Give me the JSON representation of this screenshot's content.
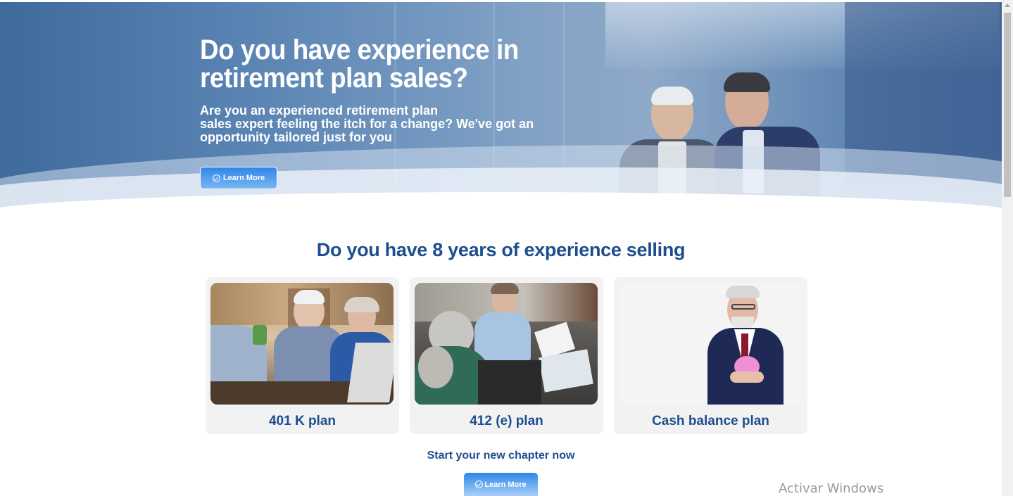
{
  "hero": {
    "title": "Do you have experience in retirement plan sales?",
    "subtitle": "Are you an experienced retirement plan\nsales expert  feeling the itch for a change? We've got an\nopportunity tailored just for you",
    "button_label": "Learn More",
    "button_icon": "check-circle-icon"
  },
  "section": {
    "title": "Do you have 8 years of experience selling",
    "cards": [
      {
        "label": "401 K plan"
      },
      {
        "label": "412 (e) plan"
      },
      {
        "label": "Cash balance plan"
      }
    ]
  },
  "cta": {
    "text": "Start your new chapter now",
    "button_label": "Learn More",
    "button_icon": "check-circle-icon"
  },
  "overlay": {
    "watermark": "Activar Windows"
  },
  "colors": {
    "heading_blue": "#1e4d8f",
    "button_blue": "#2e86e8",
    "card_bg": "#f2f2f2"
  }
}
